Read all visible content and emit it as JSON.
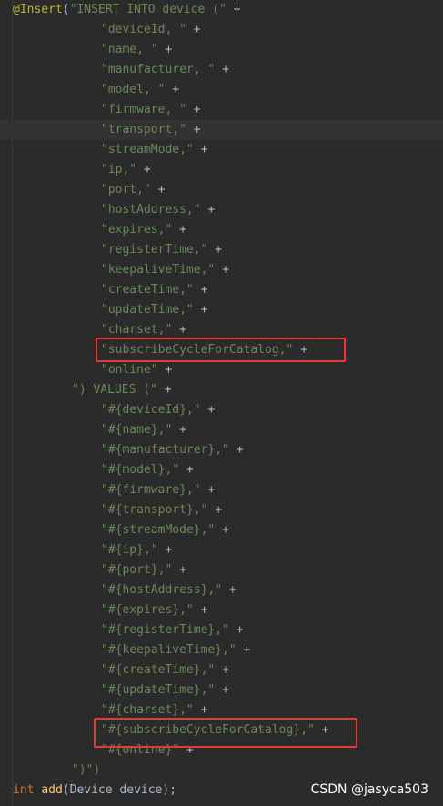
{
  "editor": {
    "annotation": "@Insert",
    "open_paren": "(",
    "insert_into": "\"INSERT INTO device (\"",
    "plus": "+",
    "columns": [
      "\"deviceId, \"",
      "\"name, \"",
      "\"manufacturer, \"",
      "\"model, \"",
      "\"firmware, \"",
      "\"transport,\"",
      "\"streamMode,\"",
      "\"ip,\"",
      "\"port,\"",
      "\"hostAddress,\"",
      "\"expires,\"",
      "\"registerTime,\"",
      "\"keepaliveTime,\"",
      "\"createTime,\"",
      "\"updateTime,\"",
      "\"charset,\"",
      "\"subscribeCycleForCatalog,\"",
      "\"online\""
    ],
    "values_clause": "\") VALUES (\"",
    "values": [
      "\"#{deviceId},\"",
      "\"#{name},\"",
      "\"#{manufacturer},\"",
      "\"#{model},\"",
      "\"#{firmware},\"",
      "\"#{transport},\"",
      "\"#{streamMode},\"",
      "\"#{ip},\"",
      "\"#{port},\"",
      "\"#{hostAddress},\"",
      "\"#{expires},\"",
      "\"#{registerTime},\"",
      "\"#{keepaliveTime},\"",
      "\"#{createTime},\"",
      "\"#{updateTime},\"",
      "\"#{charset},\"",
      "\"#{subscribeCycleForCatalog},\"",
      "\"#{online}\""
    ],
    "close_values": "\")\")",
    "method_kw": "int",
    "method_name": "add",
    "method_params": "(Device device);"
  },
  "watermark": "CSDN @jasyca503",
  "colors": {
    "background": "#2b2b2b",
    "annotation": "#bbb529",
    "string": "#6a8759",
    "keyword": "#cc7832",
    "method": "#ffc66d",
    "highlight_box": "#e53935"
  }
}
